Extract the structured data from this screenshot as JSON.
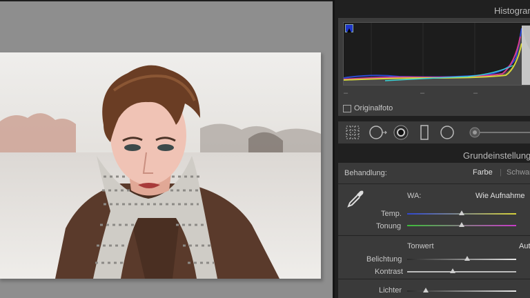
{
  "panel": {
    "histogram_title": "Histogramm",
    "original_photo_label": "Originalfoto",
    "basic_title": "Grundeinstellungen",
    "treatment_label": "Behandlung:",
    "treatment_color": "Farbe",
    "treatment_bw": "Schwarzweiß",
    "wb_label": "WA:",
    "wb_value": "Wie Aufnahme",
    "temp_label": "Temp.",
    "tint_label": "Tonung",
    "tone_label": "Tonwert",
    "auto_label": "Auto",
    "exposure_label": "Belichtung",
    "contrast_label": "Kontrast",
    "highlights_label": "Lichter"
  },
  "sliders": {
    "temp": 0.5,
    "tint": 0.5,
    "exposure": 0.55,
    "contrast": 0.42,
    "highlights": 0.17
  },
  "colors": {
    "panel_bg": "#202020",
    "block_bg": "#3a3a3a",
    "canvas_bg": "#8e8e8e"
  },
  "icons": [
    "crop-overlay-icon",
    "spot-removal-icon",
    "red-eye-icon",
    "graduated-filter-icon",
    "radial-filter-icon",
    "adjustment-brush-icon",
    "eyedropper-icon"
  ]
}
